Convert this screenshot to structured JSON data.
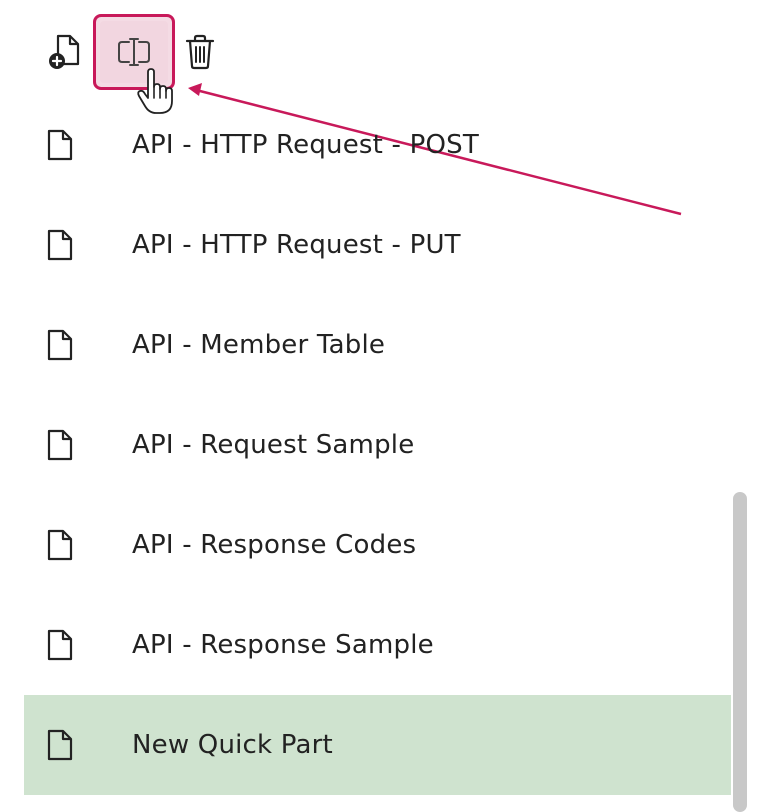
{
  "toolbar": {
    "new_icon": "new-document-icon",
    "rename_icon": "rename-text-cursor-icon",
    "delete_icon": "trash-icon",
    "highlight_color": "#c8195a"
  },
  "list": {
    "items": [
      {
        "label": "API - HTTP Request - POST",
        "icon": "document-icon"
      },
      {
        "label": "API - HTTP Request - PUT",
        "icon": "document-icon"
      },
      {
        "label": "API - Member Table",
        "icon": "document-icon"
      },
      {
        "label": "API - Request Sample",
        "icon": "document-icon"
      },
      {
        "label": "API - Response Codes",
        "icon": "document-icon"
      },
      {
        "label": "API - Response Sample",
        "icon": "document-icon"
      },
      {
        "label": "New Quick Part",
        "icon": "document-icon",
        "selected": true
      }
    ],
    "selected_color": "#cfe3cf"
  }
}
